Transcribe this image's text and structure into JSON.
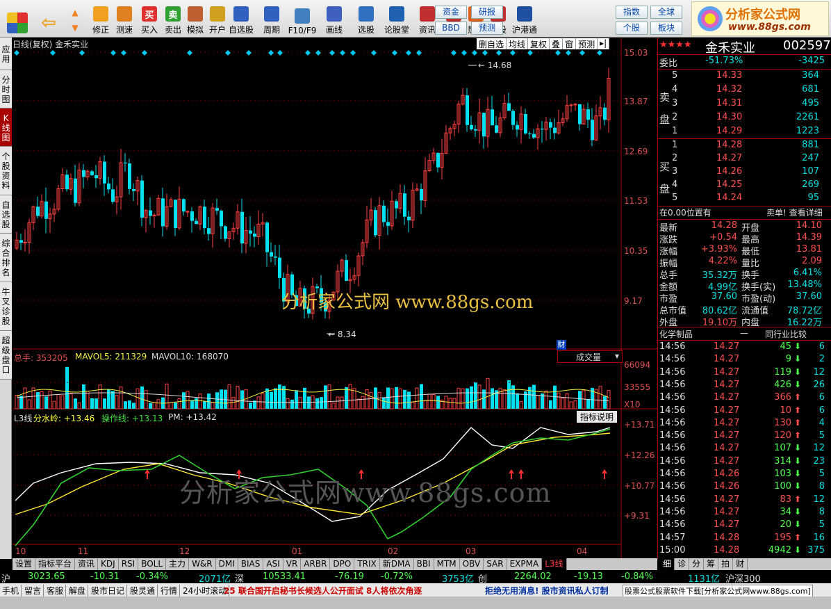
{
  "toolbar": {
    "buttons": [
      {
        "label": "修正",
        "icon": "refresh-icon",
        "color": "#f0a020"
      },
      {
        "label": "测速",
        "icon": "clock-icon",
        "color": "#e08020"
      },
      {
        "label": "买入",
        "icon": "buy-icon",
        "color": "#e03030",
        "glyph": "买"
      },
      {
        "label": "卖出",
        "icon": "sell-icon",
        "color": "#30a030",
        "glyph": "卖"
      },
      {
        "label": "模拟",
        "icon": "hammer-icon",
        "color": "#c06030"
      },
      {
        "label": "开户",
        "icon": "lock-icon",
        "color": "#d0a020"
      },
      {
        "label": "自选股",
        "icon": "star-icon",
        "color": "#3060c0"
      },
      {
        "label": "周期",
        "icon": "clock-icon",
        "color": "#3060c0"
      },
      {
        "label": "F10/F9",
        "icon": "document-icon",
        "color": "#4080c0"
      },
      {
        "label": "画线",
        "icon": "pen-icon",
        "color": "#4060c0"
      },
      {
        "label": "选股",
        "icon": "screen-icon",
        "color": "#3070c0"
      },
      {
        "label": "论股堂",
        "icon": "chat-icon",
        "color": "#2060b0"
      },
      {
        "label": "资讯",
        "icon": "grid-icon",
        "color": "#c03030"
      },
      {
        "label": "数据",
        "icon": "pe-icon",
        "color": "#c03030"
      },
      {
        "label": "热点",
        "icon": "fire-icon",
        "color": "#e06020"
      },
      {
        "label": "新股",
        "icon": "phone-icon",
        "color": "#c03030"
      },
      {
        "label": "沪港通",
        "icon": "sse-hk-icon",
        "color": "#2050a0"
      }
    ],
    "small_buttons": [
      "资金",
      "研报",
      "BBD",
      "预测",
      "指数",
      "全球",
      "个股",
      "板块"
    ],
    "logo": {
      "title": "分析家公式网",
      "url": "www.88gs.com"
    }
  },
  "left_tabs": [
    "应用",
    "分时图",
    "K线图",
    "个股资料",
    "自选股",
    "综合排名",
    "牛叉诊股",
    "超级盘口"
  ],
  "chart": {
    "title": "日线(复权) 金禾实业",
    "menu": [
      "删自选",
      "均线",
      "复权",
      "叠",
      "窗",
      "预测"
    ],
    "price_axis": [
      "15.03",
      "13.87",
      "12.69",
      "11.53",
      "10.35",
      "9.17"
    ],
    "high_label": "14.68",
    "low_label": "8.34",
    "finance_tag": "财",
    "volume_header": {
      "total": "总手: 353205",
      "mavol5": "MAVOL5: 211329",
      "mavol10": "MAVOL10: 168070"
    },
    "volume_select": "成交量",
    "volume_axis": [
      "66094",
      "33555",
      "X10"
    ],
    "ind_header": {
      "name": "L3线",
      "a": "分水岭: +13.46",
      "b": "操作线: +13.13",
      "c": "PM: +13.42"
    },
    "ind_help": "指标说明",
    "ind_axis": [
      "+13.71",
      "+12.26",
      "+10.77",
      "+9.31"
    ],
    "x_labels": [
      "10",
      "11",
      "12",
      "01",
      "02",
      "03",
      "04"
    ],
    "watermark1": "分析家公式网 www.88gs.com",
    "watermark2": "分析家公式网www.88gs.com"
  },
  "bottom_tabs": [
    "设置",
    "指标平台",
    "资讯",
    "KDJ",
    "RSI",
    "BOLL",
    "主力",
    "W&R",
    "DMI",
    "BIAS",
    "ASI",
    "VR",
    "ARBR",
    "DPO",
    "TRIX",
    "新DMA",
    "BBI",
    "MTM",
    "OBV",
    "SAR",
    "EXPMA",
    "L3线"
  ],
  "right_tabs": [
    "细",
    "诊",
    "分",
    "筹",
    "拍",
    "财"
  ],
  "quote": {
    "stars": "★★★★",
    "name": "金禾实业",
    "code": "002597",
    "weibi_label": "委比",
    "weibi": "-51.73%",
    "weicha": "-3425",
    "sell_label": "卖盘",
    "buy_label": "买盘",
    "asks": [
      {
        "lvl": "5",
        "price": "14.33",
        "vol": "364"
      },
      {
        "lvl": "4",
        "price": "14.32",
        "vol": "681"
      },
      {
        "lvl": "3",
        "price": "14.31",
        "vol": "495"
      },
      {
        "lvl": "2",
        "price": "14.30",
        "vol": "2261"
      },
      {
        "lvl": "1",
        "price": "14.29",
        "vol": "1223"
      }
    ],
    "bids": [
      {
        "lvl": "1",
        "price": "14.28",
        "vol": "881"
      },
      {
        "lvl": "2",
        "price": "14.27",
        "vol": "247"
      },
      {
        "lvl": "3",
        "price": "14.26",
        "vol": "107"
      },
      {
        "lvl": "4",
        "price": "14.25",
        "vol": "269"
      },
      {
        "lvl": "5",
        "price": "14.24",
        "vol": "95"
      }
    ],
    "zai": "在0.00位置有",
    "maidan": "卖单! 查看详细",
    "stats": [
      [
        "最新",
        "14.28",
        "开盘",
        "14.10"
      ],
      [
        "涨跌",
        "+0.54",
        "最高",
        "14.39"
      ],
      [
        "涨幅",
        "+3.93%",
        "最低",
        "13.81"
      ],
      [
        "振幅",
        "4.22%",
        "量比",
        "2.09"
      ],
      [
        "总手",
        "35.32万",
        "换手",
        "6.41%"
      ],
      [
        "金额",
        "4.99亿",
        "换手(实)",
        "13.48%"
      ],
      [
        "市盈",
        "37.60",
        "市盈(动)",
        "37.60"
      ],
      [
        "总市值",
        "80.62亿",
        "流通值",
        "78.72亿"
      ],
      [
        "外盘",
        "19.10万",
        "内盘",
        "16.22万"
      ]
    ],
    "industry": "化学制品",
    "industry_cmp": "同行业比较",
    "ticks": [
      {
        "t": "14:56",
        "p": "14.27",
        "v": "45",
        "d": "down",
        "n": "6"
      },
      {
        "t": "14:56",
        "p": "14.27",
        "v": "9",
        "d": "down",
        "n": "2"
      },
      {
        "t": "14:56",
        "p": "14.27",
        "v": "119",
        "d": "down",
        "n": "12"
      },
      {
        "t": "14:56",
        "p": "14.27",
        "v": "426",
        "d": "down",
        "n": "26"
      },
      {
        "t": "14:56",
        "p": "14.27",
        "v": "366",
        "d": "up",
        "n": "6"
      },
      {
        "t": "14:56",
        "p": "14.27",
        "v": "10",
        "d": "up",
        "n": "6"
      },
      {
        "t": "14:56",
        "p": "14.27",
        "v": "130",
        "d": "up",
        "n": "4"
      },
      {
        "t": "14:56",
        "p": "14.27",
        "v": "120",
        "d": "up",
        "n": "5"
      },
      {
        "t": "14:56",
        "p": "14.27",
        "v": "107",
        "d": "down",
        "n": "12"
      },
      {
        "t": "14:56",
        "p": "14.27",
        "v": "314",
        "d": "down",
        "n": "23"
      },
      {
        "t": "14:56",
        "p": "14.26",
        "v": "103",
        "d": "down",
        "n": "5"
      },
      {
        "t": "14:56",
        "p": "14.26",
        "v": "100",
        "d": "down",
        "n": "8"
      },
      {
        "t": "14:56",
        "p": "14.27",
        "v": "83",
        "d": "up",
        "n": "12"
      },
      {
        "t": "14:56",
        "p": "14.27",
        "v": "34",
        "d": "down",
        "n": "8"
      },
      {
        "t": "14:56",
        "p": "14.27",
        "v": "20",
        "d": "down",
        "n": "5"
      },
      {
        "t": "14:57",
        "p": "14.28",
        "v": "195",
        "d": "up",
        "n": "16"
      },
      {
        "t": "15:00",
        "p": "14.28",
        "v": "4942",
        "d": "down",
        "n": "375"
      }
    ]
  },
  "status": {
    "sh_label": "沪",
    "sh_idx": "3023.65",
    "sh_chg": "-10.31",
    "sh_pct": "-0.34%",
    "sh_amt": "2071亿",
    "sz_label": "深",
    "sz_idx": "10533.41",
    "sz_chg": "-76.19",
    "sz_pct": "-0.72%",
    "sz_amt": "3753亿",
    "cy_label": "创",
    "cy_idx": "2264.02",
    "cy_chg": "-19.13",
    "cy_pct": "-0.84%",
    "cy_amt": "1131亿",
    "hs_label": "沪深300",
    "menu": [
      "手机",
      "留言",
      "客服",
      "解盘",
      "股市日记",
      "股灵通",
      "行情",
      "24小时滚动"
    ],
    "news1": "25 联合国开启秘书长候选人公开面试 8人将依次角逐",
    "news2": "拒绝无用消息! 股市资讯私人订制",
    "footer": "股票公式股票软件下载[分析家公式网www.88gs.com]"
  }
}
